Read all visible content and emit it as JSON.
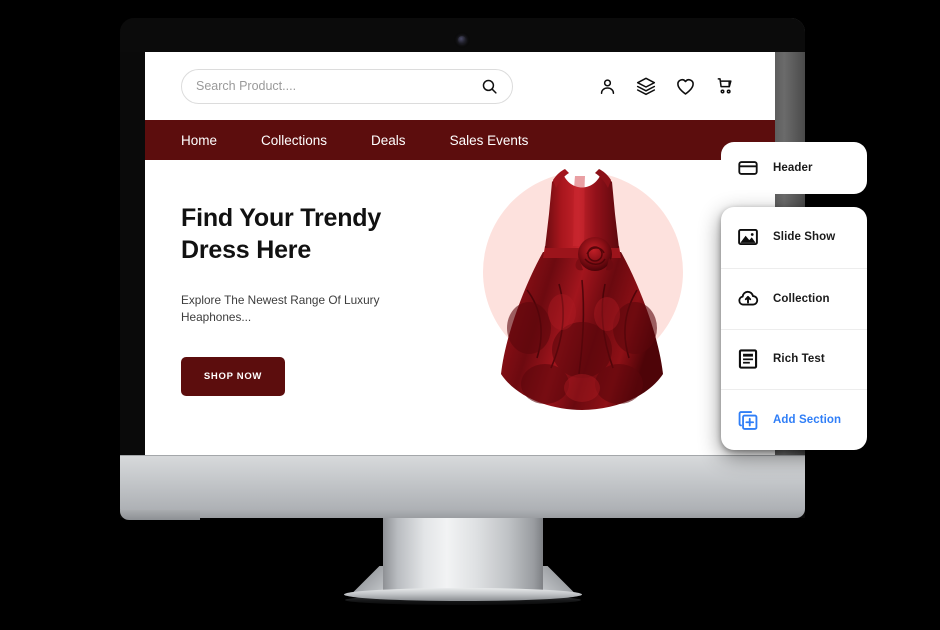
{
  "device": {
    "name": "desktop-monitor-mockup",
    "camera_icon": "camera-dot"
  },
  "site": {
    "search": {
      "placeholder": "Search Product....",
      "value": "",
      "icon": "search-icon"
    },
    "header_icons": [
      {
        "name": "account-icon",
        "label": "Account"
      },
      {
        "name": "layers-icon",
        "label": "Layers"
      },
      {
        "name": "heart-icon",
        "label": "Wishlist"
      },
      {
        "name": "cart-icon",
        "label": "Cart"
      }
    ],
    "nav": {
      "items": [
        {
          "label": "Home"
        },
        {
          "label": "Collections"
        },
        {
          "label": "Deals"
        },
        {
          "label": "Sales Events"
        }
      ]
    },
    "hero": {
      "title_line1": "Find Your Trendy",
      "title_line2": "Dress Here",
      "subtitle": "Explore The Newest Range Of Luxury Heaphones...",
      "cta_label": "SHOP NOW",
      "image_alt": "red-formal-dress"
    }
  },
  "section_panel": {
    "active_card": {
      "label": "Header",
      "icon": "card-icon"
    },
    "items": [
      {
        "label": "Slide Show",
        "icon": "image-icon"
      },
      {
        "label": "Collection",
        "icon": "cloud-upload-icon"
      },
      {
        "label": "Rich Test",
        "icon": "document-text-icon"
      },
      {
        "label": "Add Section",
        "icon": "add-square-icon",
        "accent": true
      }
    ]
  },
  "colors": {
    "brand_maroon": "#5C0D0D",
    "accent_blue": "#2F7EF7",
    "hero_circle_pink": "#FDE1DD",
    "dress_red": "#8E1118",
    "page_background": "#000000"
  }
}
